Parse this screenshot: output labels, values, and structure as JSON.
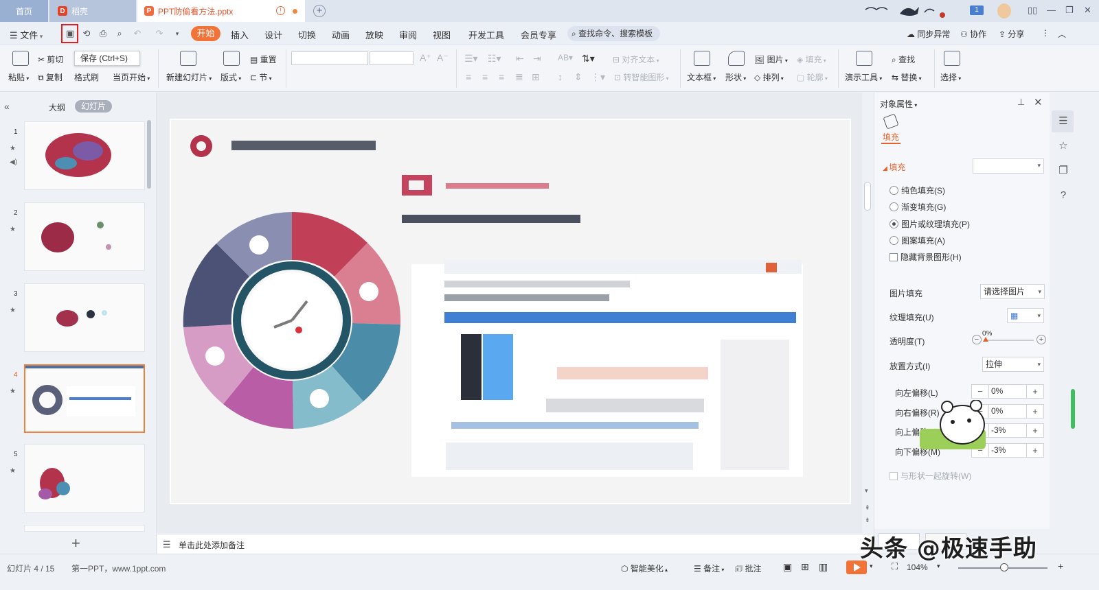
{
  "titlebar": {
    "tabs": [
      {
        "label": "首页"
      },
      {
        "label": "稻壳"
      },
      {
        "label": "PPT防偷看方法.pptx"
      }
    ],
    "badge": "1"
  },
  "menubar": {
    "file": "文件",
    "items": [
      "开始",
      "插入",
      "设计",
      "切换",
      "动画",
      "放映",
      "审阅",
      "视图",
      "开发工具",
      "会员专享"
    ],
    "search": "查找命令、搜索模板",
    "sync": "同步异常",
    "collab": "协作",
    "share": "分享"
  },
  "tooltip": "保存 (Ctrl+S)",
  "ribbon": {
    "cut": "剪切",
    "paste": "粘贴",
    "copy": "复制",
    "format_brush": "格式刷",
    "from_current": "当页开始",
    "new_slide": "新建幻灯片",
    "layout": "版式",
    "reset": "重置",
    "section": "节",
    "align_text": "对齐文本",
    "smart_shape": "转智能图形",
    "textbox": "文本框",
    "shape": "形状",
    "picture": "图片",
    "fill": "填充",
    "arrange": "排列",
    "outline": "轮廓",
    "present_tools": "演示工具",
    "find": "查找",
    "replace": "替换",
    "select": "选择"
  },
  "leftpane": {
    "outline": "大纲",
    "slides": "幻灯片",
    "thumb_numbers": [
      "1",
      "2",
      "3",
      "4",
      "5"
    ]
  },
  "notes": {
    "placeholder": "单击此处添加备注"
  },
  "rightpanel": {
    "title": "对象属性",
    "tab_fill": "填充",
    "section_fill": "填充",
    "radios": [
      {
        "label": "纯色填充(S)",
        "checked": false
      },
      {
        "label": "渐变填充(G)",
        "checked": false
      },
      {
        "label": "图片或纹理填充(P)",
        "checked": true
      },
      {
        "label": "图案填充(A)",
        "checked": false
      }
    ],
    "hide_bg": "隐藏背景图形(H)",
    "picture_fill_label": "图片填充",
    "picture_fill_value": "请选择图片",
    "texture_fill_label": "纹理填充(U)",
    "transparency_label": "透明度(T)",
    "transparency_value": "0%",
    "placement_label": "放置方式(I)",
    "placement_value": "拉伸",
    "offsets": [
      {
        "label": "向左偏移(L)",
        "value": "0%"
      },
      {
        "label": "向右偏移(R)",
        "value": "0%"
      },
      {
        "label": "向上偏移(O)",
        "value": "-3%"
      },
      {
        "label": "向下偏移(M)",
        "value": "-3%"
      }
    ],
    "rotate_with_shape": "与形状一起旋转(W)"
  },
  "statusbar": {
    "slide_index": "幻灯片 4 / 15",
    "theme": "第一PPT，www.1ppt.com",
    "smart_beautify": "智能美化",
    "notes": "备注",
    "comments": "批注",
    "zoom": "104%"
  },
  "watermark": "头条 @极速手助",
  "colors": {
    "accent": "#f27338",
    "highlight": "#e02020",
    "active_text": "#e5622c"
  }
}
